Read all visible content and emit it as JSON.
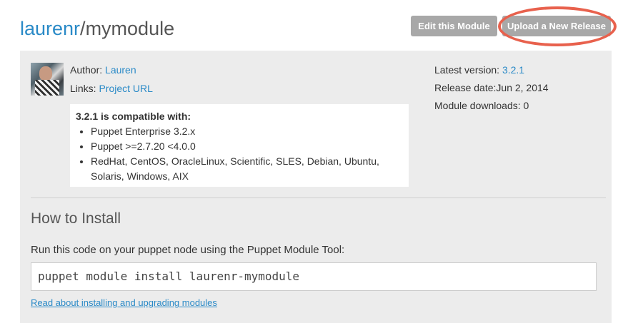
{
  "header": {
    "owner": "laurenr",
    "separator": "/",
    "module_name": "mymodule",
    "edit_button": "Edit this Module",
    "upload_button": "Upload a New Release"
  },
  "info": {
    "author_label": "Author:",
    "author_name": "Lauren",
    "links_label": "Links:",
    "project_url_label": "Project URL",
    "latest_version_label": "Latest version:",
    "latest_version": "3.2.1",
    "release_date_label": "Release date:",
    "release_date": "Jun 2, 2014",
    "downloads_label": "Module downloads:",
    "downloads": "0"
  },
  "compatibility": {
    "heading": "3.2.1 is compatible with:",
    "items": [
      "Puppet Enterprise 3.2.x",
      "Puppet >=2.7.20 <4.0.0",
      "RedHat, CentOS, OracleLinux, Scientific, SLES, Debian, Ubuntu, Solaris, Windows, AIX"
    ]
  },
  "install": {
    "title": "How to Install",
    "description": "Run this code on your puppet node using the Puppet Module Tool:",
    "command": "puppet module install laurenr-mymodule",
    "read_link": "Read about installing and upgrading modules"
  },
  "colors": {
    "link": "#2a8ac7",
    "button": "#a8a8a8",
    "highlight": "#e8614d",
    "panel": "#ececec"
  }
}
